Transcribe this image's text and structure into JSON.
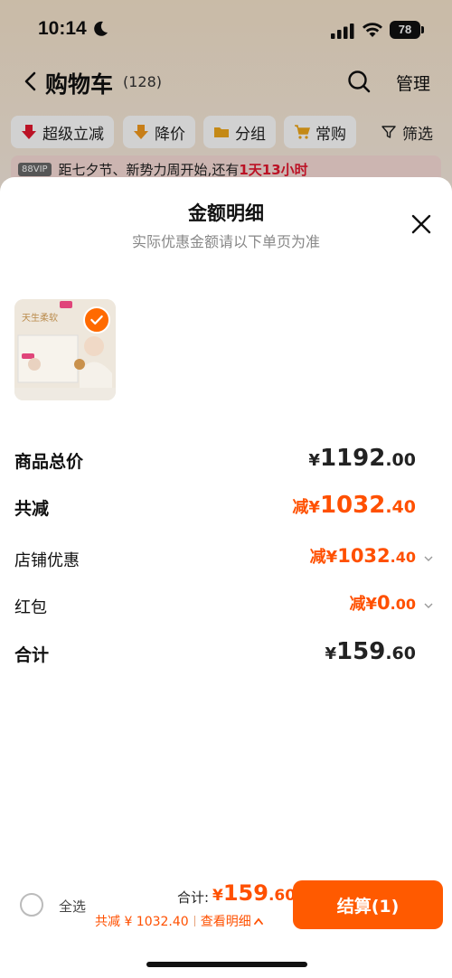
{
  "status_bar": {
    "time": "10:14",
    "battery": "78"
  },
  "nav": {
    "title": "购物车",
    "count": "(128)",
    "manage_label": "管理"
  },
  "filters": [
    {
      "label": "超级立减",
      "icon": "red-down-arrow-icon"
    },
    {
      "label": "降价",
      "icon": "orange-down-arrow-icon"
    },
    {
      "label": "分组",
      "icon": "folder-icon"
    },
    {
      "label": "常购",
      "icon": "cart-icon"
    },
    {
      "label": "筛选",
      "icon": "funnel-icon"
    }
  ],
  "promo": {
    "badge": "88VIP",
    "text": "距七夕节、新势力周开始,还有",
    "highlight": "1天13小时"
  },
  "sheet": {
    "title": "金额明细",
    "subtitle": "实际优惠金额请以下单页为准",
    "rows": [
      {
        "label": "商品总价",
        "prefix": "",
        "currency": "¥",
        "int": "1192",
        "dec": ".00"
      },
      {
        "label": "共减",
        "prefix": "减",
        "currency": "¥",
        "int": "1032",
        "dec": ".40"
      },
      {
        "label": "店铺优惠",
        "prefix": "减",
        "currency": "¥",
        "int": "1032",
        "dec": ".40"
      },
      {
        "label": "红包",
        "prefix": "减",
        "currency": "¥",
        "int": "0",
        "dec": ".00"
      },
      {
        "label": "合计",
        "prefix": "",
        "currency": "¥",
        "int": "159",
        "dec": ".60"
      }
    ]
  },
  "bottom": {
    "select_all": "全选",
    "sum_label": "合计:",
    "sum_currency": "¥",
    "sum_int": "159",
    "sum_dec": ".60",
    "reduce_text": "共减 ¥ 1032.40",
    "detail_link": "查看明细",
    "checkout": "结算(1)"
  },
  "colors": {
    "accent": "#ff5000",
    "checkout_bg": "#ff5a00"
  }
}
